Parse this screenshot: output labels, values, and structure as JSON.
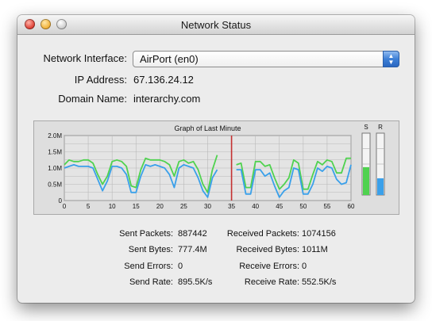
{
  "window": {
    "title": "Network Status"
  },
  "interface": {
    "label": "Network Interface:",
    "selected": "AirPort (en0)"
  },
  "ip": {
    "label": "IP Address:",
    "value": "67.136.24.12"
  },
  "domain": {
    "label": "Domain Name:",
    "value": "interarchy.com"
  },
  "graph": {
    "title": "Graph of Last Minute",
    "meter_send_label": "S",
    "meter_receive_label": "R",
    "send_level": 0.45,
    "receive_level": 0.27,
    "marker_x": 35
  },
  "chart_data": {
    "type": "line",
    "title": "Graph of Last Minute",
    "xlim": [
      0,
      60
    ],
    "ylim": [
      0,
      2.0
    ],
    "x_ticks": [
      "0",
      "5",
      "10",
      "15",
      "20",
      "25",
      "30",
      "35",
      "40",
      "45",
      "50",
      "55",
      "60"
    ],
    "y_ticks": [
      "0",
      "0.5M",
      "1.0M",
      "1.5M",
      "2.0M"
    ],
    "grid": true,
    "x": [
      0,
      1,
      2,
      3,
      4,
      5,
      6,
      7,
      8,
      9,
      10,
      11,
      12,
      13,
      14,
      15,
      16,
      17,
      18,
      19,
      20,
      21,
      22,
      23,
      24,
      25,
      26,
      27,
      28,
      29,
      30,
      31,
      32,
      33,
      34,
      35,
      36,
      37,
      38,
      39,
      40,
      41,
      42,
      43,
      44,
      45,
      46,
      47,
      48,
      49,
      50,
      51,
      52,
      53,
      54,
      55,
      56,
      57,
      58,
      59,
      60
    ],
    "series": [
      {
        "color": "#4fd24f",
        "values": [
          1.1,
          1.25,
          1.2,
          1.2,
          1.25,
          1.25,
          1.15,
          0.8,
          0.5,
          0.75,
          1.2,
          1.25,
          1.2,
          1.05,
          0.45,
          0.4,
          0.95,
          1.3,
          1.25,
          1.25,
          1.25,
          1.2,
          1.1,
          0.75,
          1.2,
          1.25,
          1.15,
          1.2,
          0.95,
          0.5,
          0.25,
          0.95,
          1.4,
          null,
          null,
          null,
          1.1,
          1.15,
          0.4,
          0.4,
          1.2,
          1.2,
          1.05,
          1.1,
          0.7,
          0.35,
          0.5,
          0.7,
          1.25,
          1.15,
          0.35,
          0.35,
          0.8,
          1.2,
          1.1,
          1.25,
          1.2,
          0.85,
          0.85,
          1.3,
          1.3
        ]
      },
      {
        "color": "#3aa0ea",
        "values": [
          1.0,
          1.05,
          1.1,
          1.05,
          1.05,
          1.05,
          1.0,
          0.65,
          0.3,
          0.6,
          1.05,
          1.05,
          1.0,
          0.8,
          0.25,
          0.25,
          0.75,
          1.1,
          1.05,
          1.1,
          1.05,
          1.0,
          0.8,
          0.4,
          1.0,
          1.1,
          1.05,
          1.0,
          0.7,
          0.3,
          0.1,
          0.7,
          0.95,
          null,
          null,
          null,
          0.95,
          0.95,
          0.2,
          0.2,
          0.95,
          0.95,
          0.75,
          0.85,
          0.45,
          0.1,
          0.3,
          0.4,
          1.0,
          0.95,
          0.2,
          0.2,
          0.5,
          1.0,
          0.9,
          1.05,
          1.0,
          0.65,
          0.5,
          0.55,
          1.1
        ]
      }
    ]
  },
  "stats": {
    "left": [
      {
        "label": "Sent Packets:",
        "value": "887442"
      },
      {
        "label": "Sent Bytes:",
        "value": "777.4M"
      },
      {
        "label": "Send Errors:",
        "value": "0"
      },
      {
        "label": "Send Rate:",
        "value": "895.5K/s"
      }
    ],
    "right": [
      {
        "label": "Received Packets:",
        "value": "1074156"
      },
      {
        "label": "Received Bytes:",
        "value": "1011M"
      },
      {
        "label": "Receive Errors:",
        "value": "0"
      },
      {
        "label": "Receive Rate:",
        "value": "552.5K/s"
      }
    ]
  }
}
